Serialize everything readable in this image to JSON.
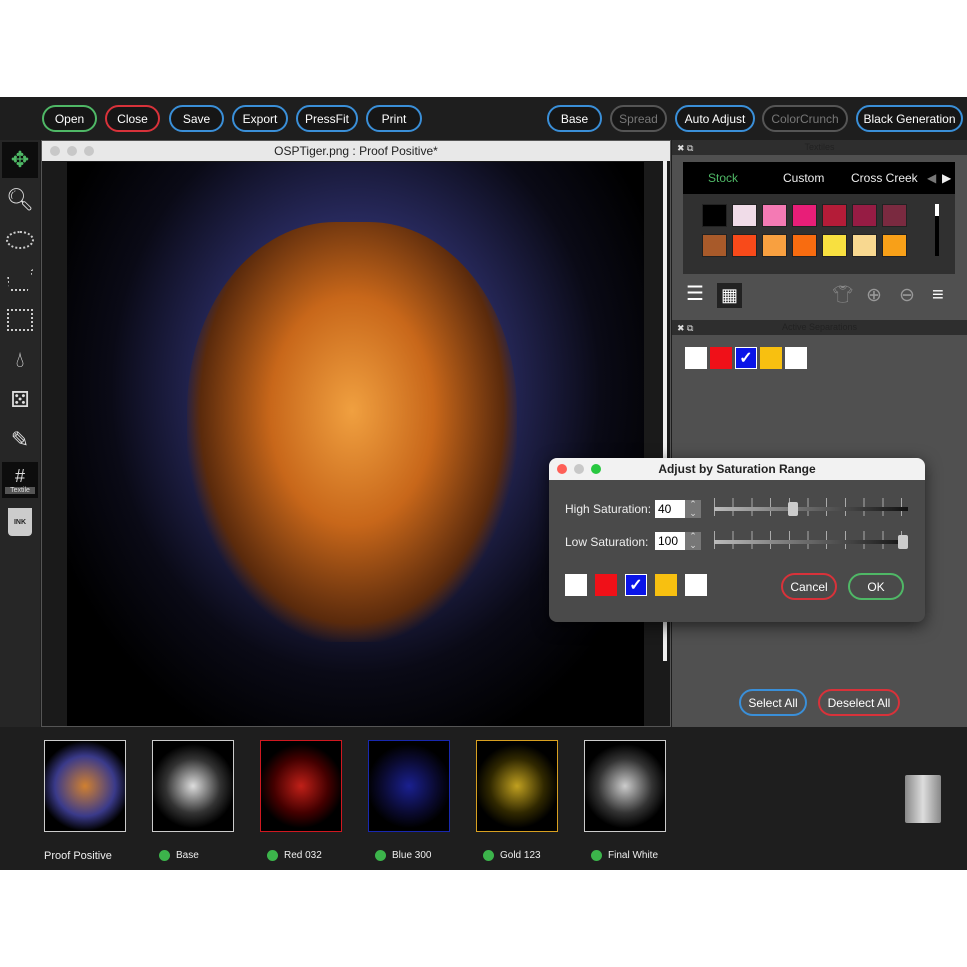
{
  "toolbar": {
    "open": "Open",
    "close": "Close",
    "save": "Save",
    "export": "Export",
    "pressfit": "PressFit",
    "print": "Print",
    "base": "Base",
    "spread": "Spread",
    "auto_adjust": "Auto Adjust",
    "colorcrunch": "ColorCrunch",
    "black_generation": "Black Generation"
  },
  "tools": {
    "textile_label": "Textile",
    "ink_label": "INK"
  },
  "document": {
    "title": "OSPTiger.png : Proof Positive*"
  },
  "textiles": {
    "title": "Textiles",
    "tabs": [
      "Stock",
      "Custom",
      "Cross Creek"
    ],
    "swatches": [
      "#000000",
      "#f0dce8",
      "#f47ab4",
      "#e81e78",
      "#b41c38",
      "#961c44",
      "#7a2a40",
      "#a85a2a",
      "#f84a1a",
      "#f8a040",
      "#f86c10",
      "#f8e040",
      "#f8d890",
      "#f8a018"
    ]
  },
  "separations": {
    "title": "Active Separations",
    "colors": [
      "#ffffff",
      "#f01018",
      "#0a14e8",
      "#f8c010",
      "#ffffff"
    ],
    "checked_index": 2,
    "select_all": "Select All",
    "deselect_all": "Deselect All"
  },
  "dialog": {
    "title": "Adjust by Saturation Range",
    "high_label": "High Saturation:",
    "high_value": "40",
    "low_label": "Low Saturation:",
    "low_value": "100",
    "high_pct": 40,
    "low_pct": 100,
    "cancel": "Cancel",
    "ok": "OK"
  },
  "thumbnails": [
    {
      "label": "Proof Positive",
      "border": "#cccccc"
    },
    {
      "label": "Base",
      "border": "#cccccc"
    },
    {
      "label": "Red 032",
      "border": "#d01820"
    },
    {
      "label": "Blue 300",
      "border": "#1828b0"
    },
    {
      "label": "Gold 123",
      "border": "#d8a020"
    },
    {
      "label": "Final White",
      "border": "#cccccc"
    }
  ]
}
